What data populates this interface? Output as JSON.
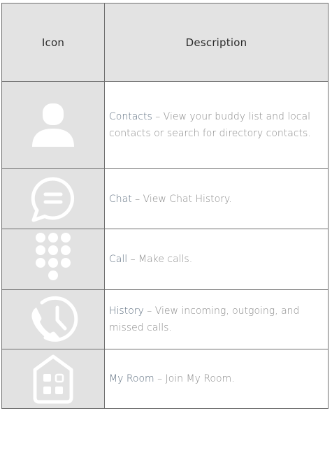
{
  "table": {
    "headers": {
      "icon": "Icon",
      "description": "Description"
    },
    "rows": [
      {
        "icon": "contacts-person-icon",
        "name": "Contacts",
        "separator": " – ",
        "text": "View your buddy list and local contacts or search for directory contacts."
      },
      {
        "icon": "chat-bubble-icon",
        "name": "Chat",
        "separator": " – ",
        "text": "View Chat History."
      },
      {
        "icon": "dialpad-icon",
        "name": "Call",
        "separator": " – ",
        "text": "Make calls."
      },
      {
        "icon": "history-clock-phone-icon",
        "name": "History",
        "separator": " – ",
        "text": "View incoming, outgoing, and missed calls."
      },
      {
        "icon": "my-room-house-icon",
        "name": "My Room",
        "separator": " – ",
        "text": "Join My Room."
      }
    ]
  },
  "colors": {
    "header_bg": "#e3e3e3",
    "icon_bg": "#e2e2e2",
    "feature_name": "#5e6f80",
    "body_text": "#8b8b8b",
    "icon_fill": "#ffffff"
  }
}
